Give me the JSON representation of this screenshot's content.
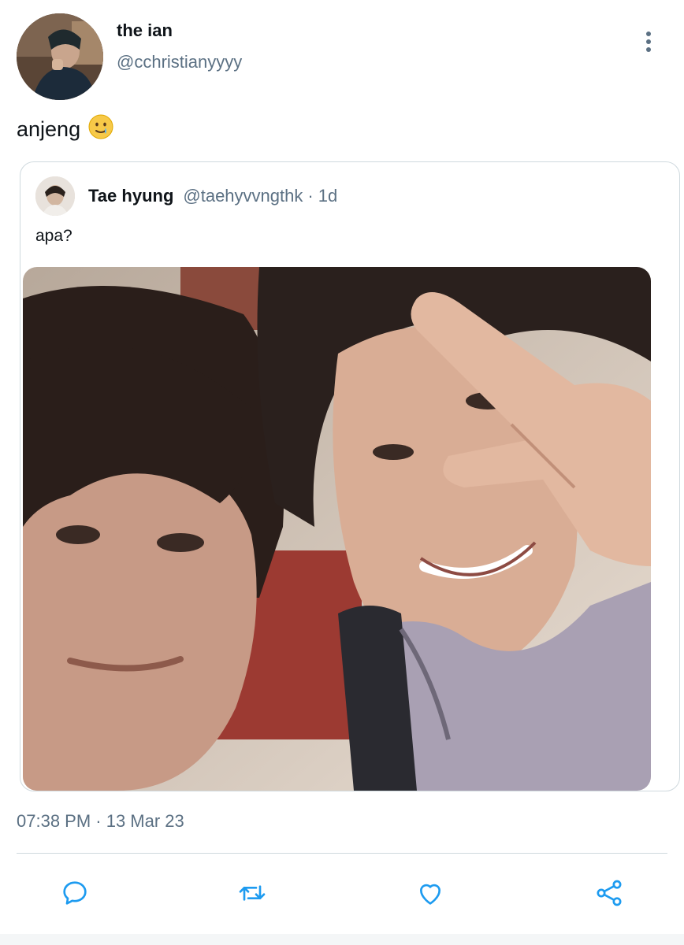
{
  "tweet": {
    "author": {
      "display_name": "the ian",
      "handle": "@cchristianyyyy",
      "avatar_icon": "profile-photo"
    },
    "more_icon": "more-vertical-icon",
    "text": "anjeng",
    "emoji": "🥲",
    "timestamp": "07:38 PM · 13 Mar 23"
  },
  "quoted_tweet": {
    "display_name": "Tae hyung",
    "handle": "@taehyvvngthk",
    "separator": "·",
    "relative_time": "1d",
    "text": "apa?",
    "image_icon": "selfie-photo"
  },
  "actions": [
    {
      "name": "reply",
      "icon": "comment-icon"
    },
    {
      "name": "retweet",
      "icon": "retweet-icon"
    },
    {
      "name": "like",
      "icon": "heart-icon"
    },
    {
      "name": "share",
      "icon": "share-icon"
    }
  ],
  "colors": {
    "secondary_text": "#5b7083",
    "primary_text": "#0f1419",
    "border": "#cfd9de",
    "action_icon": "#1d9bf0"
  }
}
